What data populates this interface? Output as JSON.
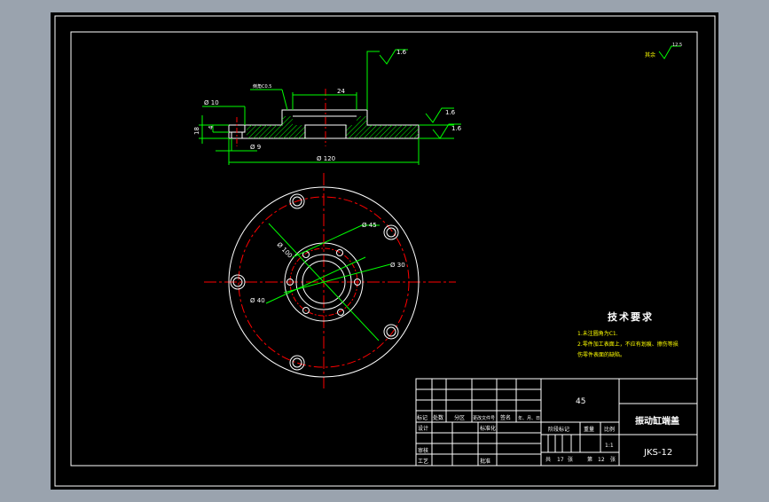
{
  "colors": {
    "background": "#000000",
    "frame": "#ffffff",
    "dimension": "#00ff00",
    "centerline": "#ff0000",
    "hatch": "#00ff00",
    "text_green": "#00ff00",
    "text_yellow": "#ffff00",
    "outer_bg": "#9aa3ae"
  },
  "roughness": {
    "top": "1.6",
    "right1": "1.6",
    "right2": "1.6",
    "corner_label": "其余",
    "corner_value": "12.5"
  },
  "section_view": {
    "chamfer_label": "倒角C0.5",
    "dim_width_top": "24",
    "dim_phi10": "Ø 10",
    "dim_phi9": "Ø 9",
    "dim_height": "18",
    "dim_depth": "4",
    "dim_phi120": "Ø 120"
  },
  "plan_view": {
    "dim_phi100": "Ø 100",
    "dim_phi45": "Ø 45",
    "dim_phi30": "Ø 30",
    "dim_phi40": "Ø 40"
  },
  "tech_req": {
    "title": "技术要求",
    "line1": "1.未注圆角为C1.",
    "line2": "2.零件加工表面上，不应有划痕、擦伤等损",
    "line3": "伤零件表面的缺陷。"
  },
  "title_block": {
    "material": "45",
    "part_name": "振动缸端盖",
    "drawing_no": "JKS-12",
    "h_biaoji": "标记",
    "h_chushu": "处数",
    "h_fenqu": "分区",
    "h_gengwen": "更改文件号",
    "h_qianming": "签名",
    "h_date": "年、月、日",
    "h_sheji": "设计",
    "h_biaozhunhua": "标准化",
    "h_shenhe": "审核",
    "h_gongyi": "工艺",
    "h_pizhun": "批准",
    "h_jieduan": "阶段标记",
    "h_zhongliang": "重量",
    "h_bili": "比例",
    "scale": "1:1",
    "total_label": "共",
    "total_num": "17",
    "zhang1": "张",
    "page_label": "第",
    "page_num": "12",
    "zhang2": "张"
  }
}
